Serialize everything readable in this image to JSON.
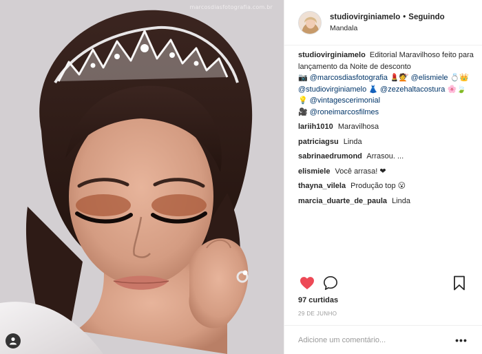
{
  "photo": {
    "watermark": "marcosdiasfotografia.com.br",
    "alt": "studiovirginiamelo"
  },
  "header": {
    "username": "studiovirginiamelo",
    "separator": "•",
    "follow_label": "Seguindo",
    "location": "Mandala"
  },
  "caption": {
    "username": "studiovirginiamelo",
    "text_1": "Editorial Maravilhoso feito para lançamento da Noite de desconto",
    "glyph_1": "📷",
    "mention_1": "@marcosdiasfotografia",
    "glyph_2": "💄💇",
    "mention_2": "@elismiele",
    "glyph_3": "💍👑",
    "mention_3": "@studiovirginiamelo",
    "glyph_4": "👗",
    "mention_4": "@zezehaltacostura",
    "glyph_5": "🌸🍃💡",
    "mention_5": "@vintagescerimonial",
    "glyph_6": "🎥",
    "mention_6": "@roneimarcosfilmes"
  },
  "comments": [
    {
      "username": "lariih1010",
      "text": "Maravilhosa"
    },
    {
      "username": "patriciagsu",
      "text": "Linda"
    },
    {
      "username": "sabrinaedrumond",
      "text": "Arrasou. ..."
    },
    {
      "username": "elismiele",
      "text": "Você arrasa! ❤"
    },
    {
      "username": "thayna_vilela",
      "text": "Produção top 😮"
    },
    {
      "username": "marcia_duarte_de_paula",
      "text": "Linda"
    }
  ],
  "actions": {
    "like_icon": "heart-filled-icon",
    "comment_icon": "speech-bubble-icon",
    "save_icon": "bookmark-icon",
    "like_color": "#ed4956"
  },
  "likes": "97 curtidas",
  "date": "29 DE JUNHO",
  "add_comment": {
    "placeholder": "Adicione um comentário...",
    "more_label": "•••"
  }
}
